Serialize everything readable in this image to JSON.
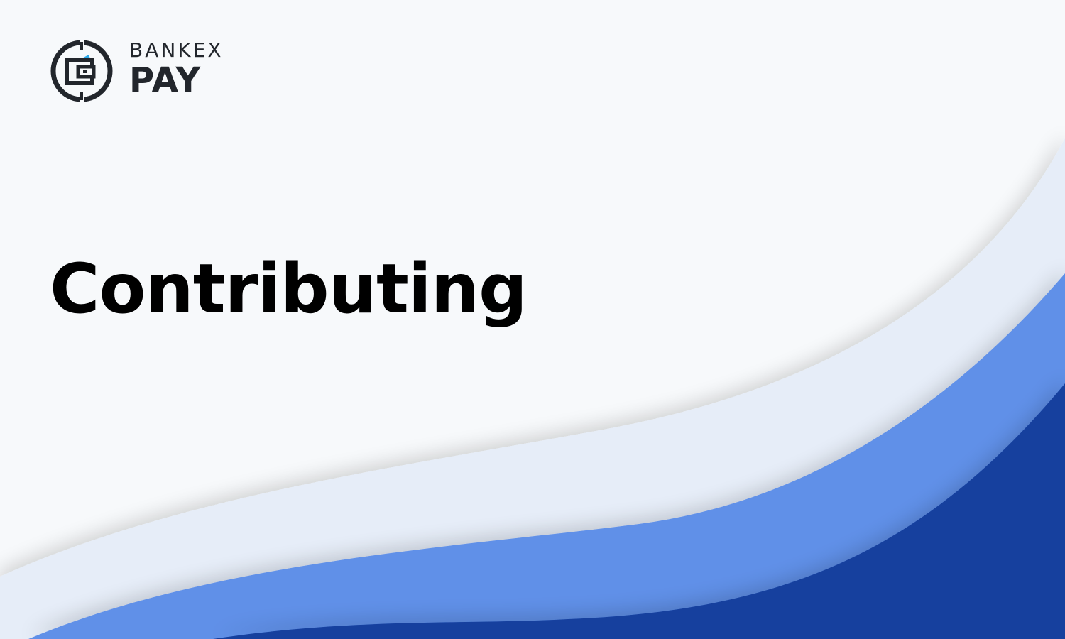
{
  "logo": {
    "word_top": "BANKEX",
    "word_bottom": "PAY",
    "icon": "wallet-icon"
  },
  "page": {
    "title": "Contributing"
  },
  "colors": {
    "background": "#f7f9fb",
    "wave_light": "#e6edf8",
    "wave_mid": "#6190e8",
    "wave_dark": "#143f9e",
    "logo_dark": "#22262c",
    "logo_accent": "#2aa8e8",
    "title": "#000000"
  }
}
